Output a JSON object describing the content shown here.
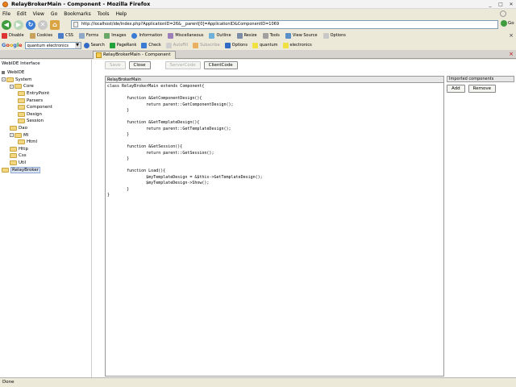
{
  "window": {
    "title": "RelayBrokerMain - Component - Mozilla Firefox"
  },
  "menu": [
    "File",
    "Edit",
    "View",
    "Go",
    "Bookmarks",
    "Tools",
    "Help"
  ],
  "navbar": {
    "url": "http://localhost/ide/index.php?ApplicationID=26&__parent[0]=ApplicationID&ComponentID=1069",
    "go_label": "Go"
  },
  "dev_toolbar": {
    "items": [
      "Disable",
      "Cookies",
      "CSS",
      "Forms",
      "Images",
      "Information",
      "Miscellaneous",
      "Outline",
      "Resize",
      "Tools",
      "View Source",
      "Options"
    ]
  },
  "google_bar": {
    "logo": "Google",
    "search_value": "quantum electronics",
    "items": [
      "Search",
      "PageRank",
      "Check",
      "AutoFill",
      "Subscribe",
      "Options",
      "quantum",
      "electronics"
    ]
  },
  "tab": {
    "label": "RelayBrokerMain - Component"
  },
  "sidebar": {
    "header": "WebIDE Interface",
    "tree": [
      {
        "label": "WebIDE",
        "depth": 0,
        "type": "root"
      },
      {
        "label": "System",
        "depth": 0,
        "type": "folder",
        "toggle": "-"
      },
      {
        "label": "Core",
        "depth": 1,
        "type": "folder",
        "toggle": "-"
      },
      {
        "label": "EntryPoint",
        "depth": 2,
        "type": "folder"
      },
      {
        "label": "Parsers",
        "depth": 2,
        "type": "folder"
      },
      {
        "label": "Component",
        "depth": 2,
        "type": "folder"
      },
      {
        "label": "Design",
        "depth": 2,
        "type": "folder"
      },
      {
        "label": "Session",
        "depth": 2,
        "type": "folder"
      },
      {
        "label": "Dao",
        "depth": 1,
        "type": "folder"
      },
      {
        "label": "Ml",
        "depth": 1,
        "type": "folder",
        "toggle": "-"
      },
      {
        "label": "Html",
        "depth": 2,
        "type": "folder"
      },
      {
        "label": "Http",
        "depth": 1,
        "type": "folder"
      },
      {
        "label": "Css",
        "depth": 1,
        "type": "folder"
      },
      {
        "label": "Util",
        "depth": 1,
        "type": "folder"
      },
      {
        "label": "RelayBroker",
        "depth": 0,
        "type": "folder",
        "selected": true
      }
    ]
  },
  "toolbar": {
    "save_label": "Save",
    "close_label": "Close",
    "servercode_label": "ServerCode",
    "clientcode_label": "ClientCode"
  },
  "editor": {
    "title": "RelayBrokerMain",
    "code": "class RelayBrokerMain extends Component{\n\n        function &GetComponentDesign(){\n                return parent::GetComponentDesign();\n        }\n\n        function &GetTemplateDesign(){\n                return parent::GetTemplateDesign();\n        }\n\n        function &GetSession(){\n                return parent::GetSession();\n        }\n\n        function Load(){\n                $myTemplateDesign = &$this->GetTemplateDesign();\n                $myTemplateDesign->Show();\n        }\n}"
  },
  "imports": {
    "title": "Imported components",
    "add_label": "Add",
    "remove_label": "Remove"
  },
  "status": {
    "text": "Done"
  }
}
